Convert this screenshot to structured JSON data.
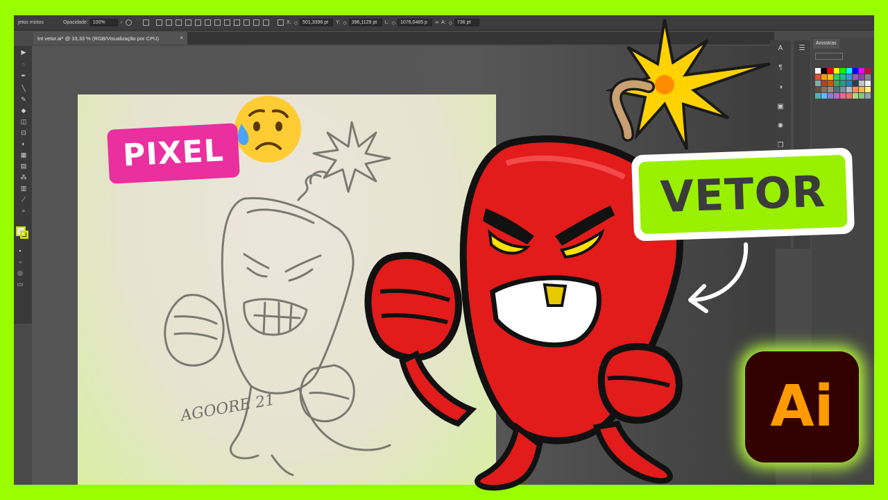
{
  "control_bar": {
    "mixed_objects_label": "jetos mistos",
    "opacity_label": "Opacidade:",
    "opacity_value": "100%",
    "x_label": "X:",
    "x_value": "501,3396 pt",
    "y_label": "Y:",
    "y_value": "396,1129 pt",
    "w_label": "L:",
    "w_value": "1076,0485 p",
    "h_label": "A:",
    "h_value": "736 pt"
  },
  "document_tab": {
    "title": "tnt vetor.ai* @ 33,33 % (RGB/Visualização por CPU)",
    "close": "×"
  },
  "swatches_panel": {
    "tab_label": "Amostras"
  },
  "overlays": {
    "pixel_label": "PIXEL",
    "vetor_label": "VETOR",
    "ai_logo_text": "Ai",
    "signature_text": "AGOORE 21"
  },
  "colors": {
    "frame_green": "#99ff00",
    "pixel_pink": "#ea2f9e",
    "vetor_green": "#99f000",
    "bomb_red": "#e11c1c",
    "ai_orange": "#ff9a00",
    "ai_bg": "#330000"
  },
  "icons": {
    "emoji": "worried-face-icon",
    "arrow": "curved-arrow-icon"
  }
}
